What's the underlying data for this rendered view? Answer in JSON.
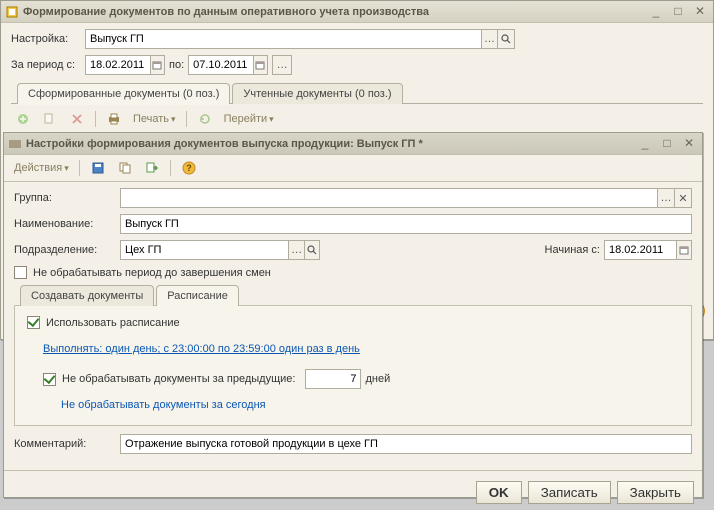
{
  "parent": {
    "title": "Формирование документов по данным оперативного учета производства",
    "settingLabel": "Настройка:",
    "settingValue": "Выпуск ГП",
    "periodLabel": "За период с:",
    "periodFrom": "18.02.2011",
    "periodToLabel": "по:",
    "periodTo": "07.10.2011",
    "tabs": {
      "formed": "Сформированные документы (0 поз.)",
      "posted": "Учтенные документы (0 поз.)"
    },
    "toolbar": {
      "print": "Печать",
      "goto": "Перейти"
    }
  },
  "child": {
    "title": "Настройки формирования документов выпуска продукции: Выпуск ГП *",
    "actions": "Действия",
    "groupLabel": "Группа:",
    "groupValue": "",
    "nameLabel": "Наименование:",
    "nameValue": "Выпуск ГП",
    "divisionLabel": "Подразделение:",
    "divisionValue": "Цех ГП",
    "startingLabel": "Начиная с:",
    "startingValue": "18.02.2011",
    "noProcessShift": "Не обрабатывать период до завершения смен",
    "tabs": {
      "create": "Создавать документы",
      "schedule": "Расписание"
    },
    "schedule": {
      "useSchedule": "Использовать расписание",
      "execPrefix": "Выполнять:",
      "execRest": " один день; с 23:00:00 по 23:59:00 один раз в день",
      "noProcessPrev": "Не обрабатывать документы за предыдущие:",
      "daysValue": "7",
      "daysSuffix": "дней",
      "noProcessToday": "Не обрабатывать документы за сегодня"
    },
    "commentLabel": "Комментарий:",
    "commentValue": "Отражение выпуска готовой продукции в цехе ГП",
    "footer": {
      "ok": "OK",
      "save": "Записать",
      "close": "Закрыть"
    }
  }
}
